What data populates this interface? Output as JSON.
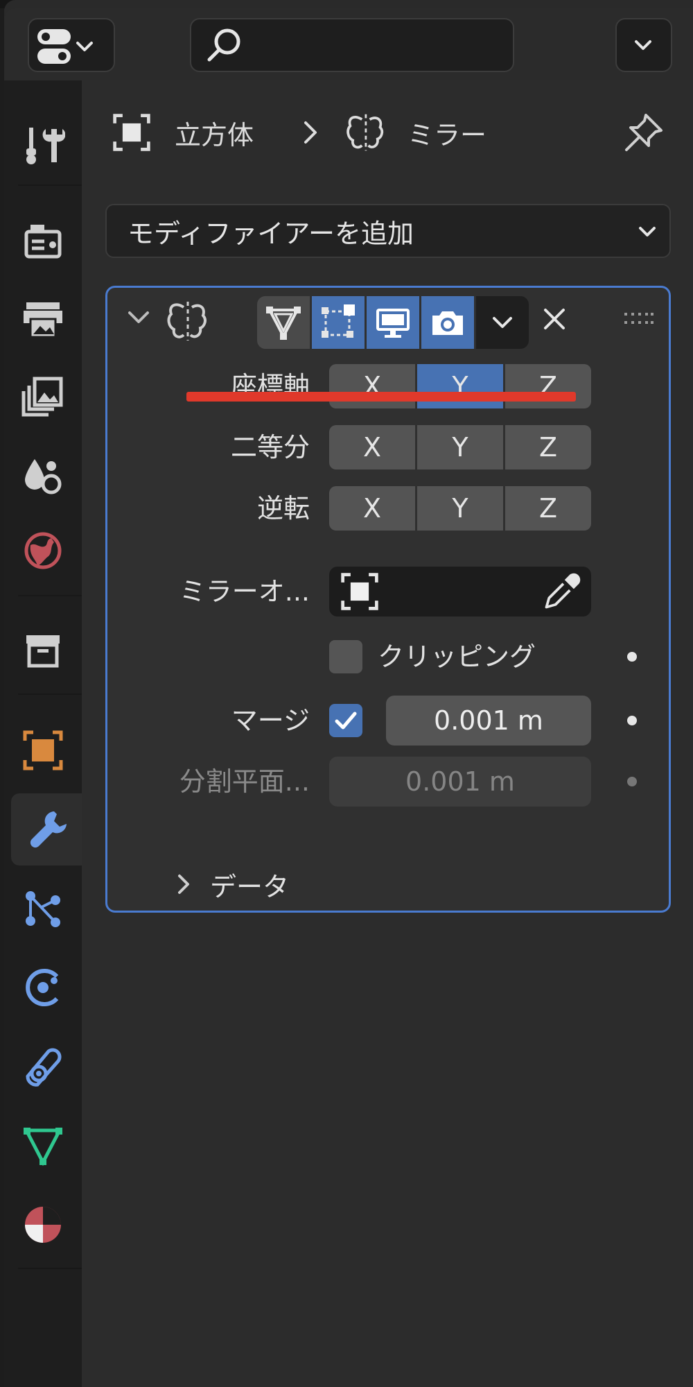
{
  "header": {
    "editor_type_icon": "properties-editor-icon",
    "search_placeholder": "",
    "options_icon": "chevron-down-icon"
  },
  "tabs": [
    {
      "name": "tool",
      "icon": "tool-wrench-screwdriver-icon",
      "color": "#cfcfcf"
    },
    {
      "name": "render",
      "icon": "render-camera-back-icon",
      "color": "#cfcfcf"
    },
    {
      "name": "output",
      "icon": "output-printer-icon",
      "color": "#cfcfcf"
    },
    {
      "name": "view-layer",
      "icon": "view-layer-images-icon",
      "color": "#cfcfcf"
    },
    {
      "name": "scene",
      "icon": "scene-icon",
      "color": "#cfcfcf"
    },
    {
      "name": "world",
      "icon": "world-globe-icon",
      "color": "#c0525a"
    },
    {
      "name": "collection",
      "icon": "collection-box-icon",
      "color": "#cfcfcf"
    },
    {
      "name": "object",
      "icon": "object-icon",
      "color": "#d9893e"
    },
    {
      "name": "modifiers",
      "icon": "modifier-wrench-icon",
      "color": "#6f9ee8",
      "active": true
    },
    {
      "name": "particles",
      "icon": "particles-icon",
      "color": "#6f9ee8"
    },
    {
      "name": "physics",
      "icon": "physics-icon",
      "color": "#6f9ee8"
    },
    {
      "name": "constraints",
      "icon": "object-constraints-icon",
      "color": "#6f9ee8"
    },
    {
      "name": "data",
      "icon": "mesh-data-icon",
      "color": "#2fc78f"
    },
    {
      "name": "material",
      "icon": "material-icon",
      "color": "#c0525a"
    }
  ],
  "breadcrumb": {
    "object_label": "立方体",
    "modifier_label": "ミラー"
  },
  "add_modifier_label": "モディファイアーを追加",
  "modifier": {
    "axis_label": "座標軸",
    "bisect_label": "二等分",
    "flip_label": "逆転",
    "axis_buttons": [
      "X",
      "Y",
      "Z"
    ],
    "axis_active": "Y",
    "mirror_object_label": "ミラーオ...",
    "clipping_label": "クリッピング",
    "clipping_checked": false,
    "merge_label": "マージ",
    "merge_checked": true,
    "merge_value": "0.001 m",
    "bisect_distance_label": "分割平面...",
    "bisect_distance_value": "0.001 m",
    "data_subpanel_label": "データ"
  },
  "colors": {
    "accent": "#4772b3",
    "panel_border": "#4a7bd0",
    "annotation_underline": "#e0392b"
  }
}
